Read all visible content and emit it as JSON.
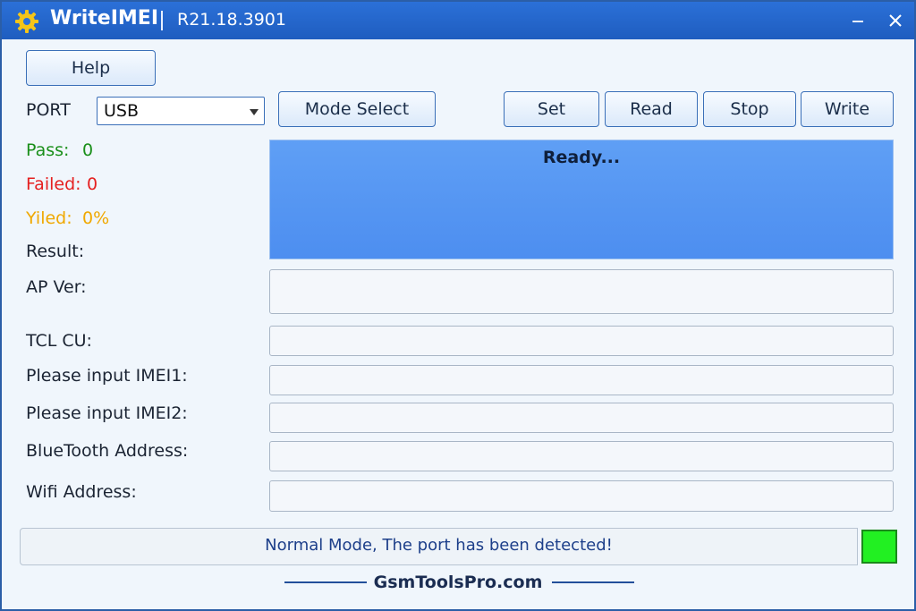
{
  "titlebar": {
    "app_name": "WriteIMEI",
    "version": "R21.18.3901",
    "icon": "gear-icon",
    "minimize_icon": "minimize-icon",
    "close_icon": "close-icon"
  },
  "toolbar": {
    "help_label": "Help",
    "port_label": "PORT",
    "port_value": "USB",
    "mode_select_label": "Mode Select",
    "set_label": "Set",
    "read_label": "Read",
    "stop_label": "Stop",
    "write_label": "Write"
  },
  "stats": {
    "pass_label": "Pass:",
    "pass_value": "0",
    "failed_label": "Failed:",
    "failed_value": "0",
    "yield_label": "Yiled:",
    "yield_value": "0%",
    "pass_color": "#1a8f1a",
    "failed_color": "#e52020",
    "yield_color": "#f0a800"
  },
  "result": {
    "label": "Result:",
    "text": "Ready..."
  },
  "fields": {
    "ap_ver_label": "AP Ver:",
    "ap_ver_value": "",
    "tcl_cu_label": "TCL CU:",
    "tcl_cu_value": "",
    "imei1_label": "Please input IMEI1:",
    "imei1_value": "",
    "imei2_label": "Please input IMEI2:",
    "imei2_value": "",
    "bt_label": "BlueTooth Address:",
    "bt_value": "",
    "wifi_label": "Wifi Address:",
    "wifi_value": ""
  },
  "status": {
    "text": "Normal Mode, The port has been detected!",
    "indicator_color": "#22f022"
  },
  "footer": {
    "text": "GsmToolsPro.com"
  }
}
